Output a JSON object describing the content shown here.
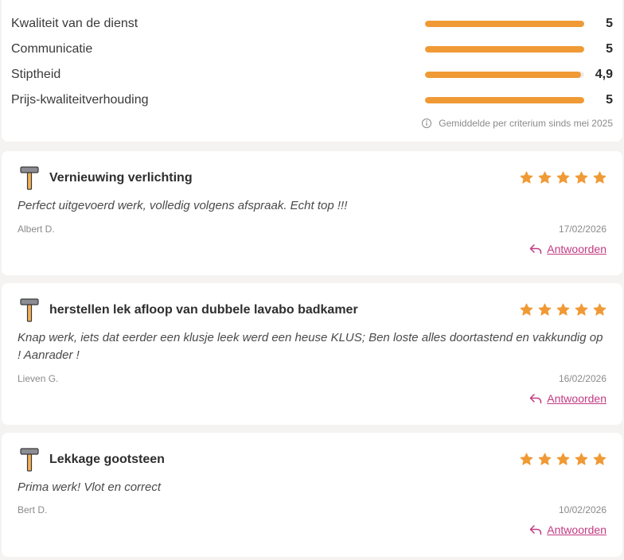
{
  "ratings": {
    "items": [
      {
        "label": "Kwaliteit van de dienst",
        "value": "5",
        "fraction": 1.0
      },
      {
        "label": "Communicatie",
        "value": "5",
        "fraction": 1.0
      },
      {
        "label": "Stiptheid",
        "value": "4,9",
        "fraction": 0.98
      },
      {
        "label": "Prijs-kwaliteitverhouding",
        "value": "5",
        "fraction": 1.0
      }
    ],
    "footnote": "Gemiddelde per criterium sinds mei 2025"
  },
  "reviews": [
    {
      "title": "Vernieuwing verlichting",
      "stars": 5,
      "text": "Perfect uitgevoerd werk, volledig volgens afspraak. Echt top !!!",
      "author": "Albert D.",
      "date": "17/02/2026",
      "reply_label": "Antwoorden"
    },
    {
      "title": "herstellen lek afloop van dubbele lavabo badkamer",
      "stars": 5,
      "text": "Knap werk, iets dat eerder een klusje leek werd een heuse KLUS; Ben loste alles doortastend en vakkundig op ! Aanrader !",
      "author": "Lieven G.",
      "date": "16/02/2026",
      "reply_label": "Antwoorden"
    },
    {
      "title": "Lekkage gootsteen",
      "stars": 5,
      "text": "Prima werk! Vlot en correct",
      "author": "Bert D.",
      "date": "10/02/2026",
      "reply_label": "Antwoorden"
    }
  ],
  "colors": {
    "accent": "#f09a35",
    "link": "#c23a82",
    "background": "#f5f3f1"
  },
  "icons": {
    "category": "hammer-icon",
    "star": "star-icon",
    "reply": "reply-icon",
    "info": "info-icon"
  }
}
